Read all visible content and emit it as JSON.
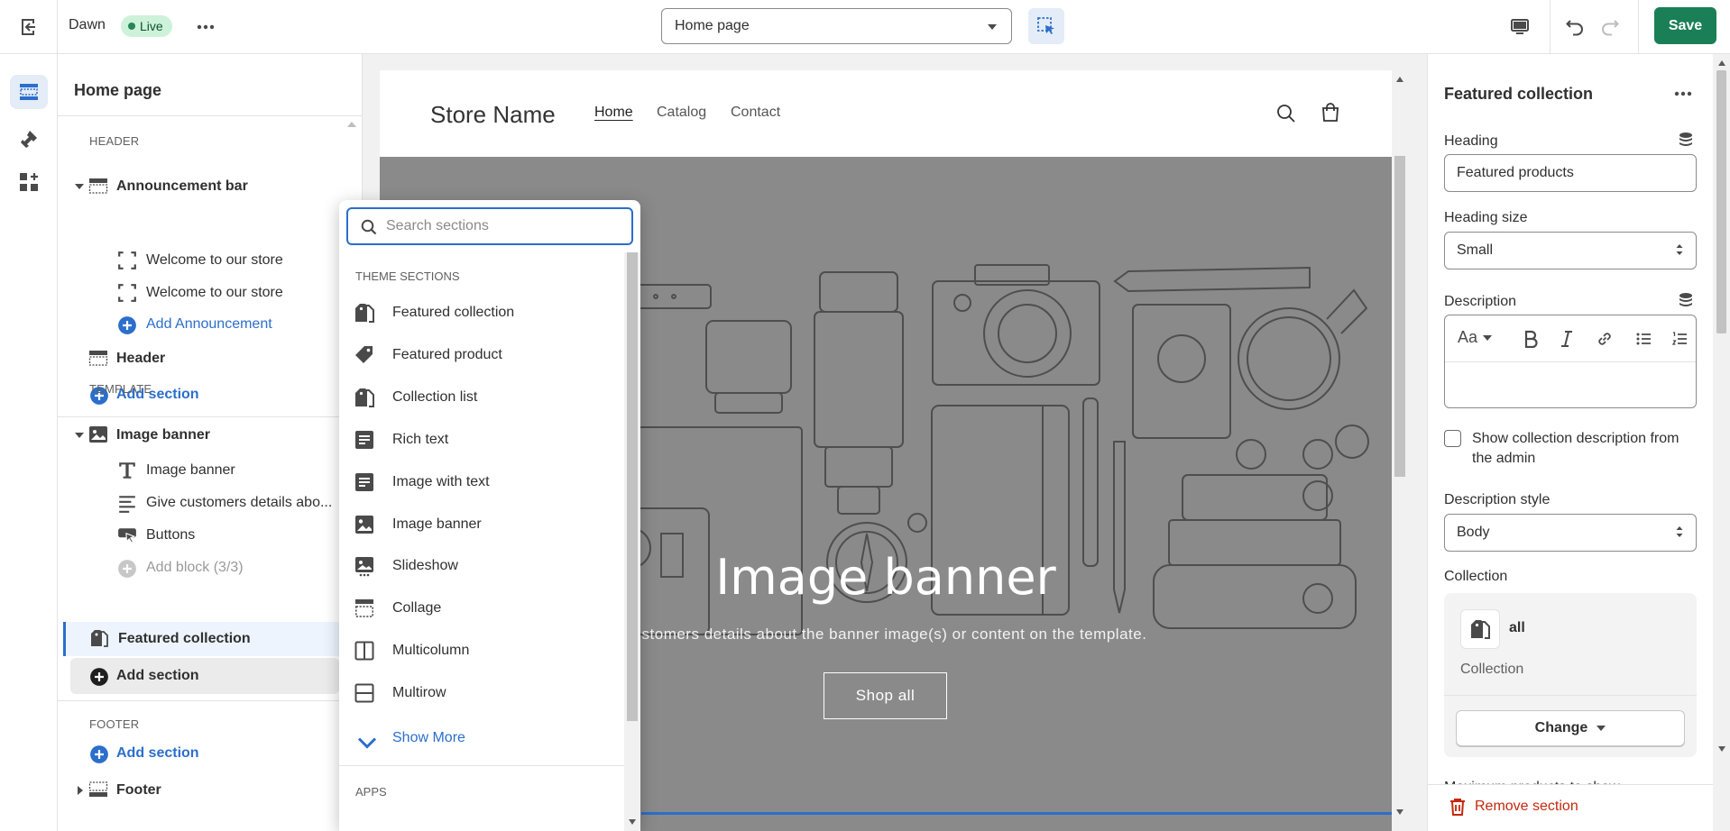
{
  "topbar": {
    "theme_name": "Dawn",
    "live_badge": "Live",
    "page_select": "Home page",
    "save_label": "Save"
  },
  "sidebar": {
    "title": "Home page",
    "header_group": "Header",
    "announcement_bar": "Announcement bar",
    "announcement_1": "Welcome to our store",
    "announcement_2": "Welcome to our store",
    "add_announcement": "Add Announcement",
    "header_section": "Header",
    "add_section_1": "Add section",
    "template_group": "Template",
    "image_banner": "Image banner",
    "block_image_banner": "Image banner",
    "block_text": "Give customers details abo...",
    "block_buttons": "Buttons",
    "add_block": "Add block (3/3)",
    "featured_collection": "Featured collection",
    "add_section_2": "Add section",
    "footer_group": "Footer",
    "add_section_3": "Add section",
    "footer_section": "Footer"
  },
  "preview": {
    "store_name": "Store Name",
    "nav": [
      "Home",
      "Catalog",
      "Contact"
    ],
    "banner_heading": "Image banner",
    "banner_text": "customers details about the banner image(s) or content on the template.",
    "banner_button": "Shop all"
  },
  "popover": {
    "search_placeholder": "Search sections",
    "theme_sections_label": "Theme sections",
    "items": [
      {
        "label": "Featured collection",
        "icon": "collection-tag-icon"
      },
      {
        "label": "Featured product",
        "icon": "product-tag-icon"
      },
      {
        "label": "Collection list",
        "icon": "collection-tag-icon"
      },
      {
        "label": "Rich text",
        "icon": "text-block-icon"
      },
      {
        "label": "Image with text",
        "icon": "image-with-text-icon"
      },
      {
        "label": "Image banner",
        "icon": "image-icon"
      },
      {
        "label": "Slideshow",
        "icon": "slideshow-icon"
      },
      {
        "label": "Collage",
        "icon": "collage-icon"
      },
      {
        "label": "Multicolumn",
        "icon": "multicolumn-icon"
      },
      {
        "label": "Multirow",
        "icon": "multirow-icon"
      }
    ],
    "show_more": "Show More",
    "apps_label": "Apps"
  },
  "right_panel": {
    "title": "Featured collection",
    "heading_label": "Heading",
    "heading_value": "Featured products",
    "heading_size_label": "Heading size",
    "heading_size_value": "Small",
    "description_label": "Description",
    "rte_font_label": "Aa",
    "checkbox_label": "Show collection description from the admin",
    "description_style_label": "Description style",
    "description_style_value": "Body",
    "collection_label": "Collection",
    "collection_name": "all",
    "collection_type": "Collection",
    "change_button": "Change",
    "max_products_label": "Maximum products to show",
    "remove_section": "Remove section"
  },
  "colors": {
    "primary_blue": "#2c6ecb",
    "save_green": "#1a7f56",
    "live_badge_bg": "#cdf2da",
    "remove_red": "#c5280c",
    "banner_gray": "#8a8a8a"
  }
}
